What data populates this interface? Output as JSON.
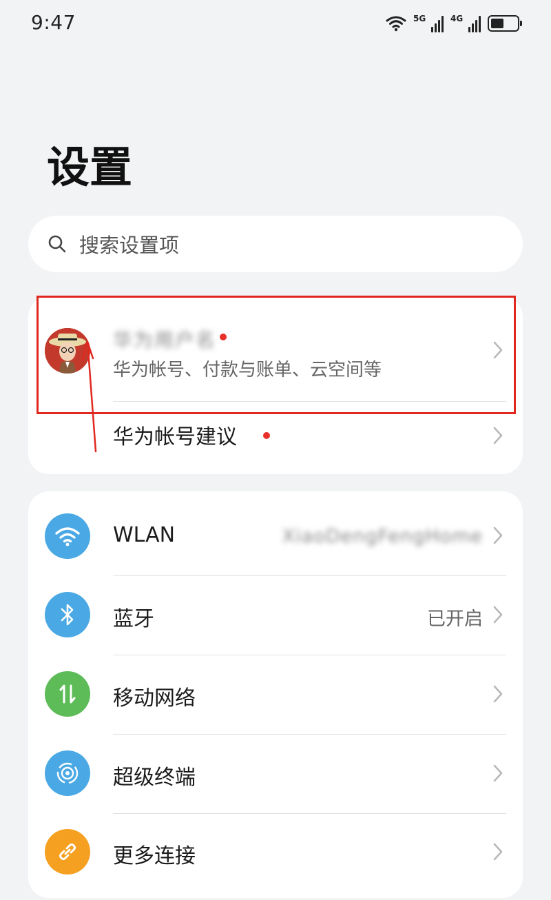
{
  "status_bar": {
    "time": "9:47",
    "wifi_icon": "wifi-icon",
    "signal_1": "5G",
    "signal_2": "4G",
    "battery_icon": "battery-icon"
  },
  "page": {
    "title": "设置"
  },
  "search": {
    "placeholder": "搜索设置项",
    "icon": "search-icon"
  },
  "account": {
    "name": "华为用户名",
    "subtitle": "华为帐号、付款与账单、云空间等",
    "suggestion_label": "华为帐号建议",
    "badge_color": "#e8302a"
  },
  "connections": [
    {
      "label": "WLAN",
      "value": "XiaoDengFengHome",
      "icon": "wifi-icon",
      "color": "#4aa9e4"
    },
    {
      "label": "蓝牙",
      "value": "已开启",
      "icon": "bluetooth-icon",
      "color": "#4aa9e4"
    },
    {
      "label": "移动网络",
      "value": "",
      "icon": "mobile-data-icon",
      "color": "#5dbb58"
    },
    {
      "label": "超级终端",
      "value": "",
      "icon": "super-device-icon",
      "color": "#4aa9e4"
    },
    {
      "label": "更多连接",
      "value": "",
      "icon": "link-icon",
      "color": "#f5a020"
    }
  ],
  "annotation_color": "#e0281f"
}
